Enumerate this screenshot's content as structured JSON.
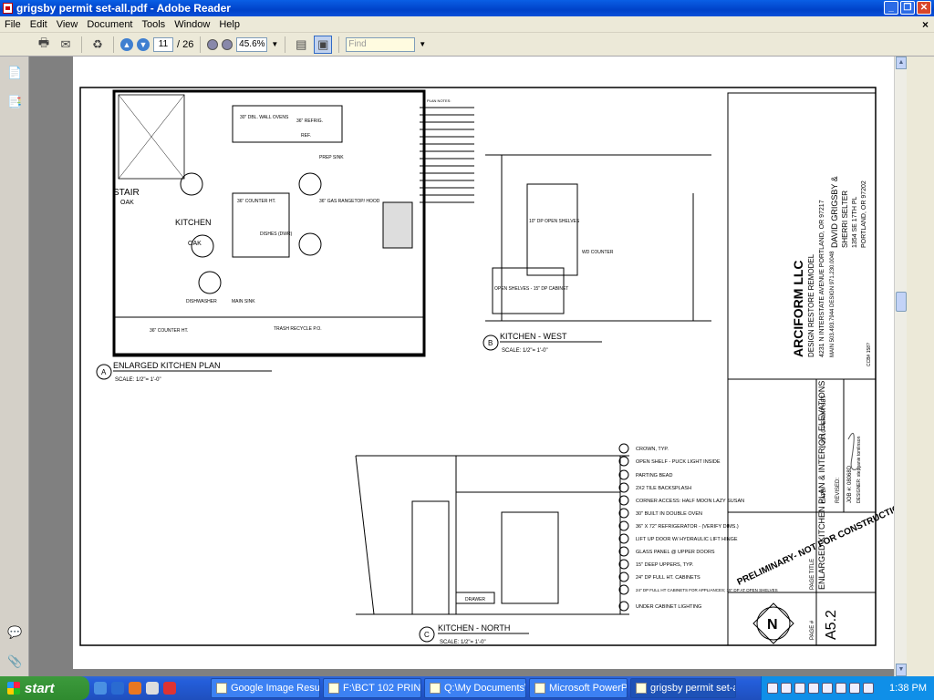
{
  "window": {
    "title": "grigsby permit set-all.pdf - Adobe Reader",
    "min": "_",
    "max": "❐",
    "close": "✕"
  },
  "menu": [
    "File",
    "Edit",
    "View",
    "Document",
    "Tools",
    "Window",
    "Help"
  ],
  "menu_close": "×",
  "toolbar": {
    "page_current": "11",
    "page_total": "/ 26",
    "zoom": "45.6%",
    "find_placeholder": "Find"
  },
  "drawing": {
    "plan_notes": "PLAN NOTES:",
    "plan_title": "ENLARGED KITCHEN PLAN",
    "plan_scale": "SCALE: 1/2\"= 1'-0\"",
    "plan_tag": "A",
    "west_title": "KITCHEN - WEST",
    "west_scale": "SCALE: 1/2\"= 1'-0\"",
    "west_tag": "B",
    "north_title": "KITCHEN - NORTH",
    "north_scale": "SCALE: 1/2\"= 1'-0\"",
    "north_tag": "C",
    "labels": {
      "stair": "STAIR",
      "oak1": "OAK",
      "kitchen": "KITCHEN",
      "oak2": "OAK",
      "counter": "36\" COUNTER HT.",
      "dishes": "DISHES (DWR)",
      "range": "36\" GAS RANGETOP/ HOOD",
      "ovens": "30\" DBL. WALL OVENS",
      "refrig": "36\" REFRIG.",
      "ref": "REF.",
      "prep": "PREP SINK",
      "dishwasher": "DISHWASHER",
      "mainsink": "MAIN SINK",
      "trash": "TRASH RECYCLE P.O.",
      "counter2": "36\" COUNTER HT.",
      "open_shelves": "10\" DP OPEN SHELVES",
      "wd_counter": "WD COUNTER",
      "open_shelves2": "OPEN SHELVES - 15\" DP CABINET",
      "drawer": "DRAWER"
    },
    "legend": [
      "CROWN, TYP.",
      "OPEN SHELF - PUCK LIGHT INSIDE",
      "PARTING BEAD",
      "2X2 TILE BACKSPLASH",
      "CORNER ACCESS: HALF MOON LAZY SUSAN",
      "30\" BUILT IN DOUBLE OVEN",
      "36\" X 72\" REFRIGERATOR - (VERIFY DIMS.)",
      "LIFT UP DOOR W/ HYDRAULIC LIFT HINGE",
      "GLASS PANEL @ UPPER DOORS",
      "15\" DEEP UPPERS, TYP.",
      "24\" DP FULL HT. CABINETS",
      "24\" DP FULL HT CABINETS FOR APPLIANCES; 15\" DP AT OPEN SHELVES",
      "UNDER CABINET LIGHTING"
    ],
    "stamp": "PRELIMINARY- NOT FOR CONSTRUCTION",
    "client": [
      "DAVID GRIGSBY &",
      "SHERRI SELTER",
      "1354 SE 17TH PL",
      "PORTLAND, OR 97202"
    ],
    "firm": "ARCIFORM LLC",
    "firm_sub": "DESIGN RESTORE REMODEL",
    "firm_addr": "4231 N INTERSTATE AVENUE PORTLAND, OR 97217",
    "firm_phone": "MAIN 503.493.7944  DESIGN 971.230.0048",
    "ccb": "CCB# 158?",
    "date_label": "DATE:",
    "date_val": "1-21-10 PERMIT SET",
    "revised_label": "REVISED:",
    "job": "JOB #: 08068D",
    "designer": "DESIGNER: stephanie tomlinson",
    "page_title_label": "PAGE TITLE",
    "page_title": "ENLARGED KITCHEN PLAN & INTERIOR ELEVATIONS",
    "page_num_label": "PAGE #",
    "page_num": "A5.2",
    "north": "N"
  },
  "taskbar": {
    "start": "start",
    "tasks": [
      "Google Image Resul...",
      "F:\\BCT 102 PRINT R...",
      "Q:\\My Documents\\M...",
      "Microsoft PowerPoin...",
      "grigsby permit set-al..."
    ],
    "clock": "1:38 PM"
  }
}
